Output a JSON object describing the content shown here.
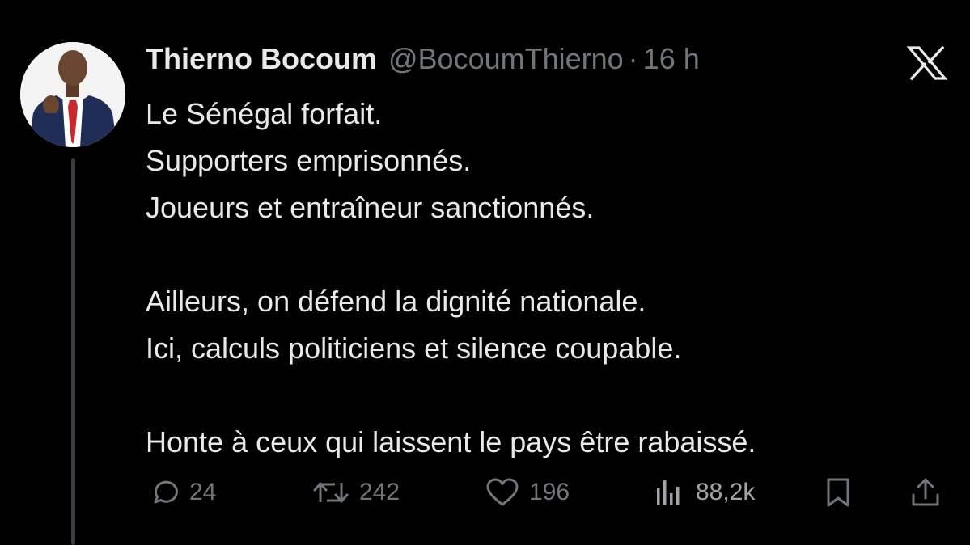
{
  "tweet": {
    "author": {
      "display_name": "Thierno Bocoum",
      "handle": "@BocoumThierno",
      "separator": "·",
      "time": "16 h"
    },
    "body_lines": [
      "Le Sénégal forfait.",
      "Supporters emprisonnés.",
      "Joueurs et entraîneur sanctionnés.",
      "",
      "Ailleurs, on défend la dignité nationale.",
      "Ici, calculs politiciens et silence coupable.",
      "",
      "Honte à ceux qui laissent le pays être rabaissé."
    ],
    "actions": {
      "replies": "24",
      "reposts": "242",
      "likes": "196",
      "views": "88,2k"
    }
  },
  "icons": {
    "brand": "x-logo-icon",
    "reply": "reply-icon",
    "repost": "repost-icon",
    "like": "heart-icon",
    "views": "views-chart-icon",
    "bookmark": "bookmark-icon",
    "share": "share-icon"
  },
  "colors": {
    "background": "#000000",
    "text_primary": "#e7e9ea",
    "text_secondary": "#71767b",
    "thread_line": "#3a3d41"
  }
}
